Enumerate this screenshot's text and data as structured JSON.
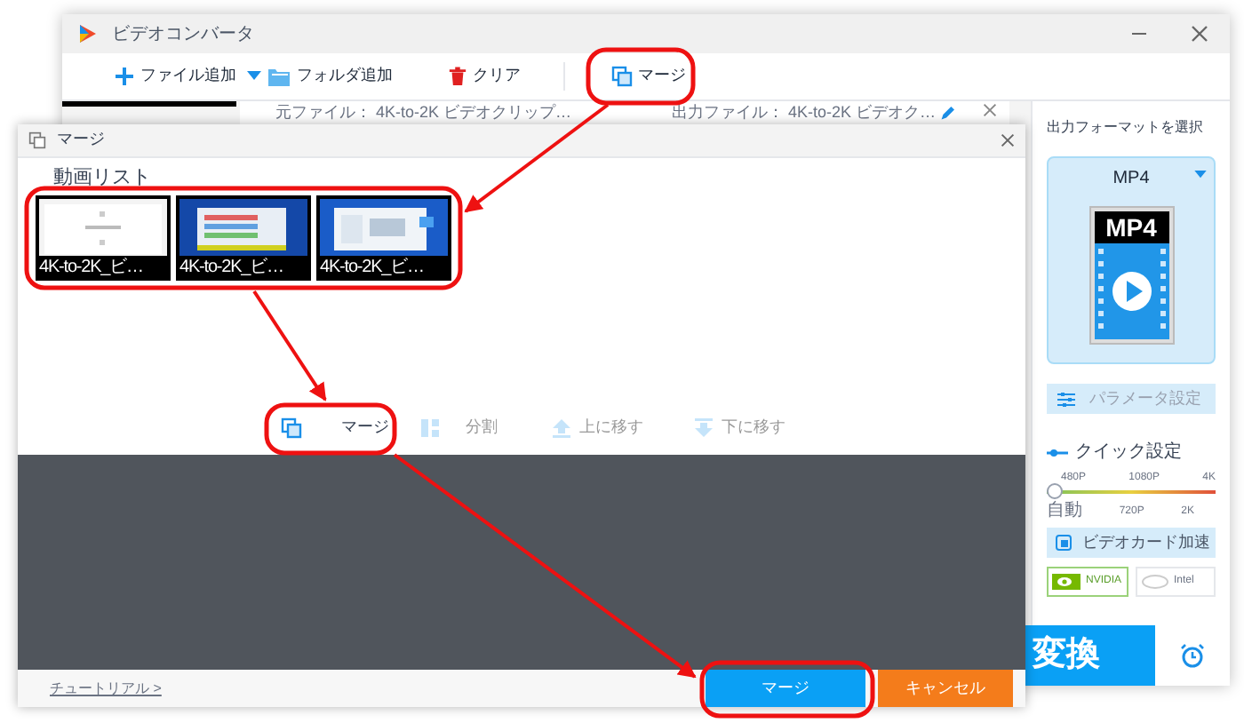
{
  "window": {
    "title": "ビデオコンバータ"
  },
  "toolbar": [
    {
      "label": "ファイル追加",
      "kind": "add"
    },
    {
      "label": "フォルダ追加",
      "kind": "folder"
    },
    {
      "label": "クリア",
      "kind": "clear"
    },
    {
      "label": "マージ",
      "kind": "merge"
    }
  ],
  "file_row": {
    "source": "元ファイル： 4K-to-2K ビデオクリップ…",
    "output": "出力ファイル： 4K-to-2K ビデオク…"
  },
  "format_panel": {
    "heading": "出力フォーマットを選択",
    "format": "MP4",
    "badge": "MP4",
    "parameter_button": "パラメータ設定"
  },
  "quick_settings": {
    "title": "クイック設定",
    "level": 0,
    "top_labels": [
      "480P",
      "1080P",
      "4K"
    ],
    "bottom_labels": [
      "自動",
      "720P",
      "2K"
    ]
  },
  "gpu": {
    "label": "ビデオカード加速",
    "checked": true,
    "vendors": [
      {
        "label": "NVIDIA",
        "selected": true
      },
      {
        "label": "Intel",
        "selected": false
      }
    ]
  },
  "convert_button": "変換",
  "dialog": {
    "title": "マージ",
    "list_heading": "動画リスト",
    "clips": [
      {
        "label": "4K-to-2K_ビ…",
        "kind": "picture"
      },
      {
        "label": "4K-to-2K_ビ…",
        "kind": "picture"
      },
      {
        "label": "4K-to-2K_ビ…",
        "kind": "picture"
      }
    ],
    "actions": [
      {
        "label": "マージ",
        "kind": "merge",
        "disabled": false
      },
      {
        "label": "分割",
        "kind": "split",
        "disabled": true
      },
      {
        "label": "上に移す",
        "kind": "up",
        "disabled": true
      },
      {
        "label": "下に移す",
        "kind": "down",
        "disabled": true
      }
    ],
    "tutorial_link": "チュートリアル >",
    "buttons": [
      {
        "label": "マージ",
        "kind": "primary"
      },
      {
        "label": "キャンセル",
        "kind": "cancel"
      }
    ]
  }
}
